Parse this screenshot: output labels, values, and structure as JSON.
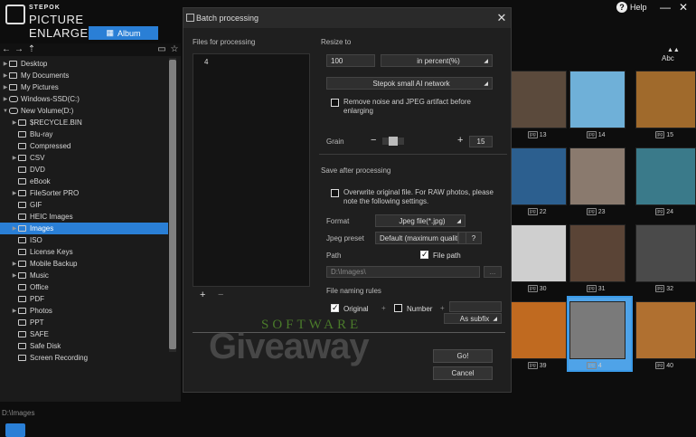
{
  "app": {
    "logo_small": "STEPOK",
    "logo_big": "PICTURE ENLARGER",
    "album_label": "Album",
    "help_label": "Help"
  },
  "sidebar": {
    "items": [
      {
        "label": "Desktop",
        "type": "folder",
        "arrow": "▶",
        "indent": 0
      },
      {
        "label": "My Documents",
        "type": "folder",
        "arrow": "▶",
        "indent": 0
      },
      {
        "label": "My Pictures",
        "type": "folder",
        "arrow": "▶",
        "indent": 0
      },
      {
        "label": "Windows-SSD(C:)",
        "type": "drive",
        "arrow": "▶",
        "indent": 0
      },
      {
        "label": "New Volume(D:)",
        "type": "drive",
        "arrow": "▼",
        "indent": 0
      },
      {
        "label": "$RECYCLE.BIN",
        "type": "folder",
        "arrow": "▶",
        "indent": 1
      },
      {
        "label": "Blu-ray",
        "type": "folder",
        "arrow": "",
        "indent": 1
      },
      {
        "label": "Compressed",
        "type": "folder",
        "arrow": "",
        "indent": 1
      },
      {
        "label": "CSV",
        "type": "folder",
        "arrow": "▶",
        "indent": 1
      },
      {
        "label": "DVD",
        "type": "folder",
        "arrow": "",
        "indent": 1
      },
      {
        "label": "eBook",
        "type": "folder",
        "arrow": "",
        "indent": 1
      },
      {
        "label": "FileSorter PRO",
        "type": "folder",
        "arrow": "▶",
        "indent": 1
      },
      {
        "label": "GIF",
        "type": "folder",
        "arrow": "",
        "indent": 1
      },
      {
        "label": "HEIC Images",
        "type": "folder",
        "arrow": "",
        "indent": 1
      },
      {
        "label": "Images",
        "type": "folder",
        "arrow": "▶",
        "indent": 1,
        "selected": true
      },
      {
        "label": "ISO",
        "type": "folder",
        "arrow": "",
        "indent": 1
      },
      {
        "label": "License Keys",
        "type": "folder",
        "arrow": "",
        "indent": 1
      },
      {
        "label": "Mobile Backup",
        "type": "folder",
        "arrow": "▶",
        "indent": 1
      },
      {
        "label": "Music",
        "type": "folder",
        "arrow": "▶",
        "indent": 1
      },
      {
        "label": "Office",
        "type": "folder",
        "arrow": "",
        "indent": 1
      },
      {
        "label": "PDF",
        "type": "folder",
        "arrow": "",
        "indent": 1
      },
      {
        "label": "Photos",
        "type": "folder",
        "arrow": "▶",
        "indent": 1
      },
      {
        "label": "PPT",
        "type": "folder",
        "arrow": "",
        "indent": 1
      },
      {
        "label": "SAFE",
        "type": "folder",
        "arrow": "",
        "indent": 1
      },
      {
        "label": "Safe Disk",
        "type": "folder",
        "arrow": "",
        "indent": 1
      },
      {
        "label": "Screen Recording",
        "type": "folder",
        "arrow": "",
        "indent": 1
      }
    ],
    "status_path": "D:\\Images"
  },
  "grid": {
    "sort_label": "Abc",
    "thumbs": [
      {
        "label": "13",
        "color": "#5b4a3c"
      },
      {
        "label": "14",
        "color": "#6fb0d8"
      },
      {
        "label": "15",
        "color": "#a06a2c"
      },
      {
        "label": "22",
        "color": "#2c5f8f"
      },
      {
        "label": "23",
        "color": "#8a7a6e"
      },
      {
        "label": "24",
        "color": "#3a7a8a"
      },
      {
        "label": "30",
        "color": "#cfcfcf"
      },
      {
        "label": "31",
        "color": "#5a4436"
      },
      {
        "label": "32",
        "color": "#4a4a4a"
      },
      {
        "label": "39",
        "color": "#c06a20"
      },
      {
        "label": "4",
        "color": "#7a7a7a"
      },
      {
        "label": "40",
        "color": "#b07030"
      }
    ]
  },
  "dialog": {
    "title": "Batch processing",
    "files_label": "Files for processing",
    "file_count": "4",
    "add": "+",
    "remove": "−",
    "resize_label": "Resize to",
    "resize_value": "100",
    "resize_unit": "in percent(%)",
    "network": "Stepok small AI network",
    "noise_label": "Remove noise and JPEG artifact before enlarging",
    "grain_label": "Grain",
    "grain_minus": "−",
    "grain_plus": "+",
    "grain_value": "15",
    "grain_level": 0.2,
    "save_label": "Save after processing",
    "overwrite_label": "Overwrite original file. For RAW photos, please note the following settings.",
    "format_label": "Format",
    "format_value": "Jpeg file(*.jpg)",
    "preset_label": "Jpeg preset",
    "preset_value": "Default (maximum qualit",
    "preset_help": "?",
    "path_label": "Path",
    "filepath_label": "File path",
    "path_value": "D:\\Images\\",
    "path_browse": "...",
    "naming_label": "File naming rules",
    "original_label": "Original",
    "plus1": "+",
    "number_label": "Number",
    "plus2": "+",
    "subfix_value": "As subfix",
    "go_label": "Go!",
    "cancel_label": "Cancel"
  },
  "watermark": {
    "top": "SOFTWARE",
    "big": "Giveaway"
  }
}
